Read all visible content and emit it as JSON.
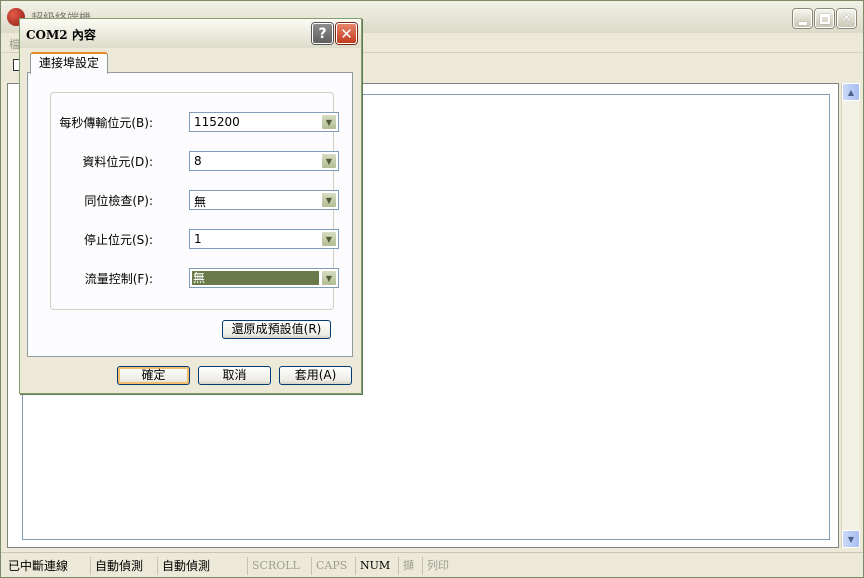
{
  "main_window": {
    "title": "超級終端機",
    "menu_first": "檔",
    "controls": {
      "minimize": "_",
      "maximize": "□",
      "close": "✕"
    }
  },
  "statusbar": {
    "connection": "已中斷連線",
    "detect1": "自動偵測",
    "detect2": "自動偵測",
    "scroll": "SCROLL",
    "caps": "CAPS",
    "num": "NUM",
    "capture": "擷",
    "print": "列印"
  },
  "dialog": {
    "title": "COM2 內容",
    "help_label": "?",
    "close_label": "✕",
    "tab": "連接埠設定",
    "fields": {
      "baud": {
        "label": "每秒傳輸位元(B):",
        "value": "115200"
      },
      "data": {
        "label": "資料位元(D):",
        "value": "8"
      },
      "parity": {
        "label": "同位檢查(P):",
        "value": "無"
      },
      "stop": {
        "label": "停止位元(S):",
        "value": "1"
      },
      "flow": {
        "label": "流量控制(F):",
        "value": "無"
      }
    },
    "restore_label": "還原成預設值(R)",
    "ok_label": "確定",
    "cancel_label": "取消",
    "apply_label": "套用(A)"
  },
  "icons": {
    "dropdown": "▼",
    "scroll_up": "▲",
    "scroll_down": "▼"
  },
  "colors": {
    "window_face": "#ece9d8",
    "focus_highlight": "#6a7a4a",
    "close_red": "#c13b1e",
    "tab_accent": "#e68b2c"
  }
}
